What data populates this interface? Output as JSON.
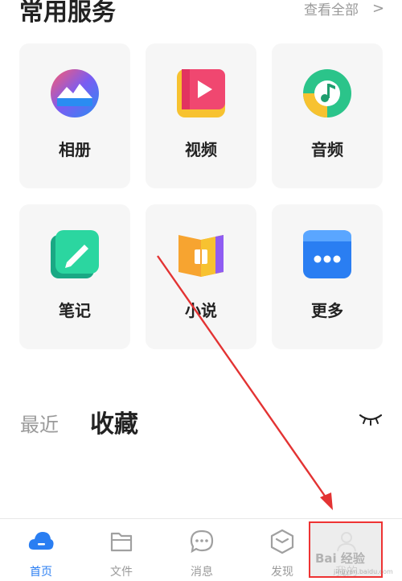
{
  "header": {
    "title": "常用服务",
    "see_all": "查看全部",
    "chevron": ">"
  },
  "services": [
    {
      "label": "相册",
      "icon": "photo-album-icon"
    },
    {
      "label": "视频",
      "icon": "video-play-icon"
    },
    {
      "label": "音频",
      "icon": "music-note-icon"
    },
    {
      "label": "笔记",
      "icon": "pencil-note-icon"
    },
    {
      "label": "小说",
      "icon": "open-book-icon"
    },
    {
      "label": "更多",
      "icon": "more-dots-icon"
    }
  ],
  "tabs": {
    "recent": "最近",
    "favorites": "收藏",
    "toggle_icon": "closed-eye-icon"
  },
  "navbar": [
    {
      "label": "首页",
      "icon": "home-cloud-icon",
      "active": true
    },
    {
      "label": "文件",
      "icon": "folder-icon",
      "active": false
    },
    {
      "label": "消息",
      "icon": "chat-bubble-icon",
      "active": false
    },
    {
      "label": "发现",
      "icon": "discover-cube-icon",
      "active": false
    },
    {
      "label": "我的",
      "icon": "profile-icon",
      "active": false
    }
  ],
  "watermark": {
    "text": "Bai 经验",
    "sub": "jingyan.baidu.com"
  },
  "colors": {
    "accent": "#2a7ef2",
    "annotation": "#e33333"
  }
}
